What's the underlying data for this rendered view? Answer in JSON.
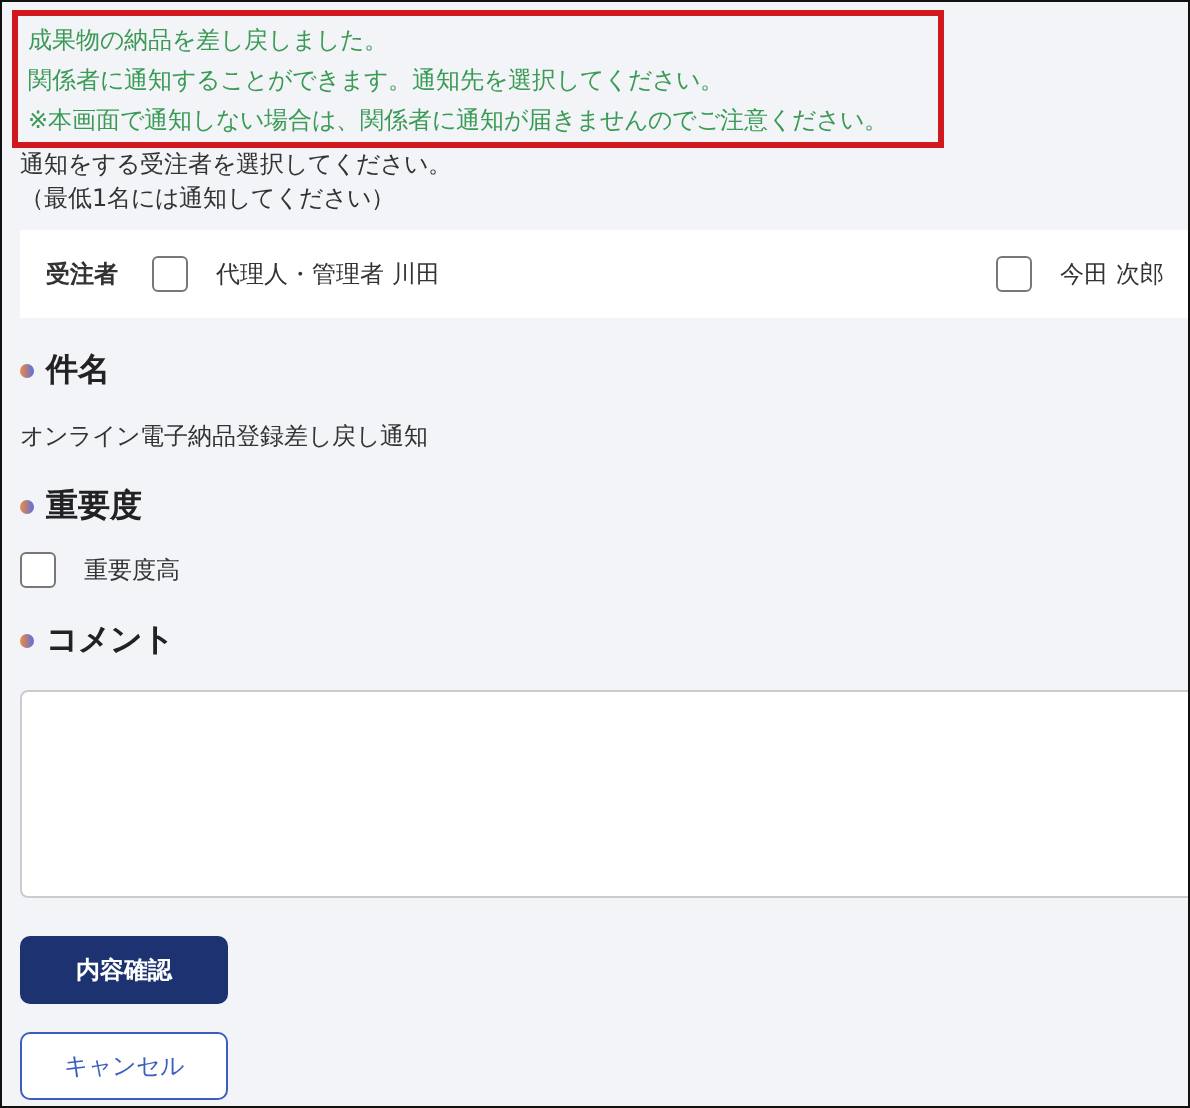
{
  "notice": {
    "lines": [
      "成果物の納品を差し戻しました。",
      "関係者に通知することができます。通知先を選択してください。",
      "※本画面で通知しない場合は、関係者に通知が届きませんのでご注意ください。"
    ]
  },
  "instructions": [
    "通知をする受注者を選択してください。",
    "（最低1名には通知してください）"
  ],
  "recipients": {
    "label": "受注者",
    "options": [
      {
        "name": "代理人・管理者 川田",
        "checked": false
      },
      {
        "name": "今田 次郎",
        "checked": false
      }
    ]
  },
  "subject": {
    "heading": "件名",
    "value": "オンライン電子納品登録差し戻し通知"
  },
  "importance": {
    "heading": "重要度",
    "option": {
      "label": "重要度高",
      "checked": false
    }
  },
  "comment": {
    "heading": "コメント"
  },
  "buttons": [
    {
      "label": "内容確認",
      "kind": "primary"
    },
    {
      "label": "キャンセル",
      "kind": "secondary"
    }
  ]
}
